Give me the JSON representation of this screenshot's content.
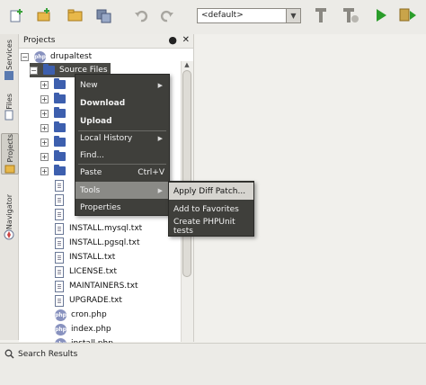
{
  "toolbar": {
    "config_combo": "<default>",
    "icons": [
      "new-file-icon",
      "new-project-icon",
      "open-project-icon",
      "save-all-icon",
      "undo-icon",
      "redo-icon",
      "build-icon",
      "clean-build-icon",
      "run-icon",
      "debug-icon"
    ]
  },
  "side_tabs": [
    "Services",
    "Files",
    "Projects",
    "Navigator"
  ],
  "projects_panel": {
    "title": "Projects",
    "project": "drupaltest",
    "source_files": "Source Files",
    "files": [
      "INSTALL.mysql.txt",
      "INSTALL.pgsql.txt",
      "INSTALL.txt",
      "LICENSE.txt",
      "MAINTAINERS.txt",
      "UPGRADE.txt",
      "cron.php",
      "index.php",
      "install.php"
    ]
  },
  "context_menu": {
    "new": "New",
    "download": "Download",
    "upload": "Upload",
    "local_history": "Local History",
    "find": "Find...",
    "paste": "Paste",
    "paste_shortcut": "Ctrl+V",
    "tools": "Tools",
    "properties": "Properties"
  },
  "tools_submenu": {
    "apply_diff": "Apply Diff Patch...",
    "add_favorites": "Add to Favorites",
    "create_phpunit": "Create PHPUnit tests"
  },
  "bottom": {
    "search_results": "Search Results"
  },
  "colors": {
    "menu_bg": "#3f3f3b",
    "folder": "#3d5fae",
    "accent_green": "#2a9d2a"
  }
}
